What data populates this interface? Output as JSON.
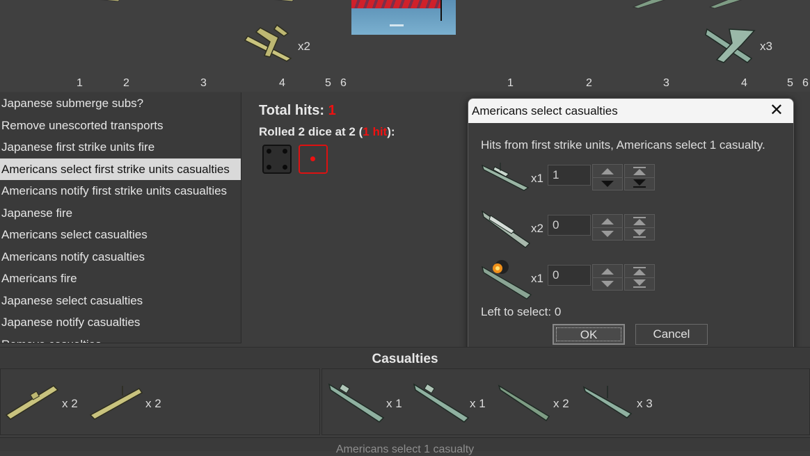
{
  "colors": {
    "accent_red": "#e11111",
    "background": "#3d3d3d"
  },
  "top_units": {
    "left_count": "x2",
    "right_count": "x3"
  },
  "ruler_left": [
    "1",
    "2",
    "3",
    "4",
    "5",
    "6"
  ],
  "ruler_right": [
    "1",
    "2",
    "3",
    "4",
    "5",
    "6"
  ],
  "steps": [
    "Japanese submerge subs?",
    "Remove unescorted transports",
    "Japanese first strike units fire",
    "Americans select first strike units casualties",
    "Americans notify first strike units casualties",
    "Japanese fire",
    "Americans select casualties",
    "Americans notify casualties",
    "Americans fire",
    "Japanese select casualties",
    "Japanese notify casualties",
    "Remove casualties"
  ],
  "selected_step_index": 3,
  "dice_panel": {
    "total_hits_label": "Total hits:",
    "total_hits_value": "1",
    "rolled_prefix": "Rolled 2 dice at 2 (",
    "rolled_hits": "1 hit",
    "rolled_suffix": "):",
    "dice": [
      4,
      1
    ]
  },
  "dialog": {
    "title": "Americans select casualties",
    "message": "Hits from first strike units,  Americans select 1 casualty.",
    "rows": [
      {
        "unit": "battleship",
        "multiplier": "x1",
        "value": "1"
      },
      {
        "unit": "destroyer",
        "multiplier": "x2",
        "value": "0"
      },
      {
        "unit": "damaged-battleship",
        "multiplier": "x1",
        "value": "0"
      }
    ],
    "left_to_select": "Left to select: 0",
    "ok_label": "OK",
    "cancel_label": "Cancel"
  },
  "casualties": {
    "header": "Casualties",
    "japanese": [
      {
        "unit": "submarine",
        "count": "x 2"
      },
      {
        "unit": "submarine",
        "count": "x 2"
      }
    ],
    "american": [
      {
        "unit": "cruiser",
        "count": "x 1"
      },
      {
        "unit": "cruiser",
        "count": "x 1"
      },
      {
        "unit": "submarine",
        "count": "x 2"
      },
      {
        "unit": "destroyer",
        "count": "x 3"
      }
    ]
  },
  "status": "Americans select 1 casualty"
}
